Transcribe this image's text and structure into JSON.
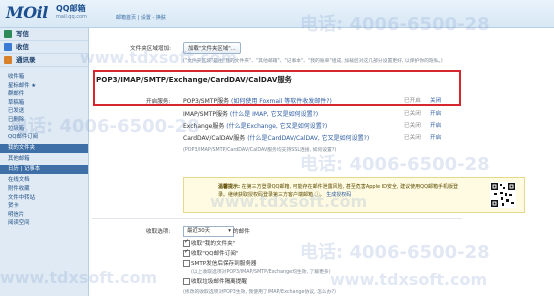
{
  "header": {
    "logo_text": "MOil",
    "logo_cn": "QQ邮箱",
    "logo_sub": "mail.qq.com",
    "top_links": "邮箱首页 | 设置 - 换肤"
  },
  "sidebar": {
    "actions": [
      {
        "label": "写信",
        "icon": "pen-icon",
        "color": "#2e8b57"
      },
      {
        "label": "收信",
        "icon": "inbox-icon",
        "color": "#3a7bd5"
      },
      {
        "label": "通讯录",
        "icon": "contacts-icon",
        "color": "#d9822b"
      }
    ],
    "items": [
      {
        "label": "收件箱",
        "star": false
      },
      {
        "label": "星标邮件 ★",
        "star": true
      },
      {
        "label": "群邮件",
        "star": false
      },
      {
        "label": "草稿箱",
        "star": false
      },
      {
        "label": "已发送",
        "star": false
      },
      {
        "label": "已删除",
        "star": false
      },
      {
        "label": "垃圾箱",
        "star": false
      },
      {
        "label": "QQ邮件订阅",
        "star": false
      }
    ],
    "folder_head": "我的文件夹",
    "folder_items": [
      "其他邮箱"
    ],
    "tools_head": "日历 | 记事本",
    "tools": [
      "在线文档",
      "附件收藏",
      "文件中转站",
      "贺卡",
      "明信片",
      "阅读空间"
    ]
  },
  "settings": {
    "folder_area": {
      "label": "文件夹区域增加:",
      "button": "加载\"文件夹区域\"...",
      "hint": "(\"文件夹区域\"是由\"我的文件夹\"、\"其他邮箱\"、\"记事本\"、\"我的账单\"组成, 加载后对这几部分设置更好, 以保护你的隐私。)"
    },
    "section_title": "POP3/IMAP/SMTP/Exchange/CardDAV/CalDAV服务",
    "enable_label": "开启服务:",
    "services": [
      {
        "name": "POP3/SMTP服务",
        "link": "(如何使用 Foxmail 等软件收发邮件?)",
        "status": "已开启",
        "action": "关闭"
      },
      {
        "name": "IMAP/SMTP服务",
        "link": "(什么是 IMAP, 它又是如何设置?)",
        "status": "已关闭",
        "action": "开启"
      },
      {
        "name": "Exchange服务",
        "link": "(什么是Exchange, 它又是如何设置?)",
        "status": "已关闭",
        "action": "开启"
      },
      {
        "name": "CardDAV/CalDAV服务",
        "link": "(什么是CardDAV/CalDAV, 它又是如何设置?)",
        "status": "已关闭",
        "action": "开启"
      }
    ],
    "ssl_hint": "(POP3/IMAP/SMTP/CardDAV/CalDAV服务均支持SSL连接, 如何设置?)",
    "tip": {
      "prefix": "温馨提示:",
      "text": "在第三方登录QQ邮箱, 可能存在邮件泄露风险, 甚至危害Apple ID安全, 建议使用QQ邮箱手机版登录。继续获取授权码登录第三方客户端邮箱 ⓘ。",
      "link": "生成授权码"
    },
    "receive_label": "收取选项:",
    "receive_select": "最近30天",
    "receive_suffix": "的邮件",
    "options": [
      {
        "label": "收取\"我的文件夹\"",
        "checked": true
      },
      {
        "label": "收取\"QQ邮件订阅\"",
        "checked": true
      },
      {
        "label": "SMTP发信后保存到服务器",
        "checked": false
      },
      {
        "label": "收取垃圾邮件隔离提醒",
        "checked": false
      }
    ],
    "smtp_note": "(以上收取选项对POP3/IMAP/SMTP/Exchange均生效, 了解更多)",
    "bottom_note": "(修改的收取选项对POP3生效, 我使用了IMAP/Exchange协议, 怎么办?)"
  },
  "watermark": {
    "phone": "电话: 4006-6500-28",
    "site": "www.tdxsoft.com"
  }
}
